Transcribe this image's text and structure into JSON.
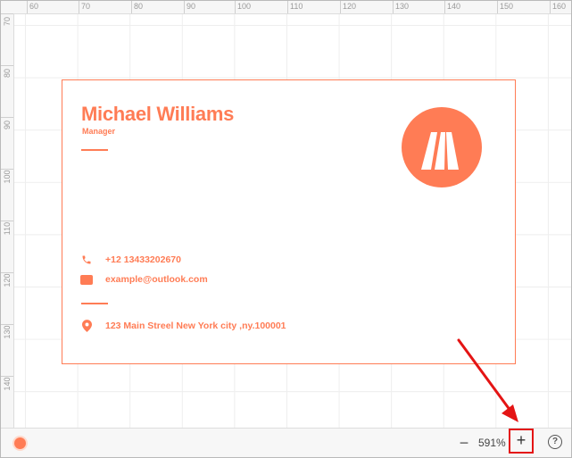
{
  "ruler": {
    "top_labels": [
      "60",
      "70",
      "80",
      "90",
      "100",
      "110",
      "120",
      "130",
      "140",
      "150",
      "160"
    ],
    "left_labels": [
      "70",
      "80",
      "90",
      "100",
      "110",
      "120",
      "130",
      "140"
    ]
  },
  "card": {
    "name": "Michael Williams",
    "job_title": "Manager",
    "phone": "+12 13433202670",
    "email": "example@outlook.com",
    "address": "123 Main Streel New York city ,ny.100001",
    "accent_color": "#ff7c55",
    "logo_icon": "brand-m-logo-icon"
  },
  "toolbar": {
    "color_swatch": "#ff7c55",
    "zoom_minus_label": "−",
    "zoom_level": "591%",
    "zoom_plus_label": "+",
    "help_label": "?"
  },
  "annotation": {
    "arrow_color": "#e41414"
  }
}
